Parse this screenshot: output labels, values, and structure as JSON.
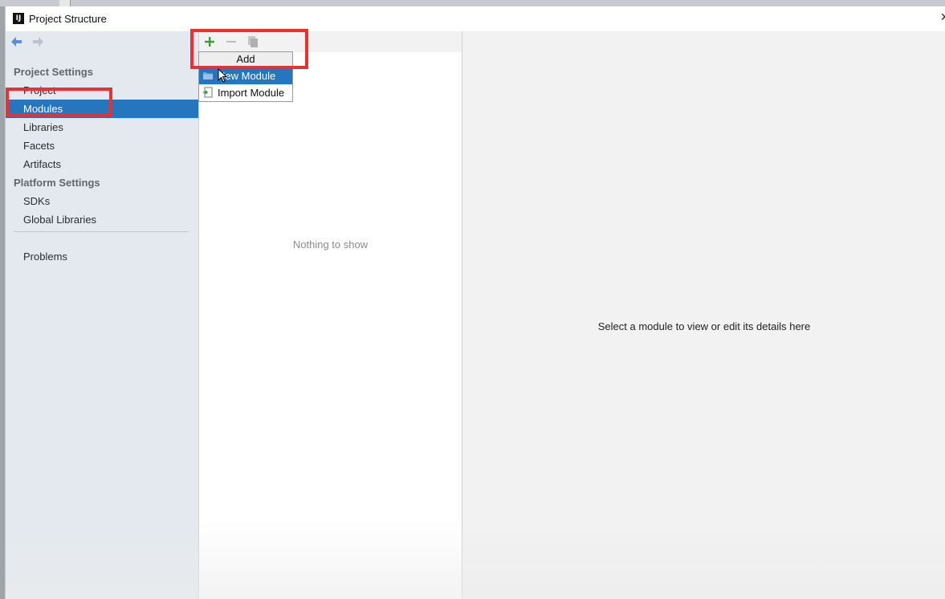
{
  "window": {
    "title": "Project Structure",
    "app_icon_text": "IJ",
    "close_glyph": "✕"
  },
  "sidebar": {
    "project_settings_header": "Project Settings",
    "platform_settings_header": "Platform Settings",
    "items": [
      {
        "label": "Project"
      },
      {
        "label": "Modules"
      },
      {
        "label": "Libraries"
      },
      {
        "label": "Facets"
      },
      {
        "label": "Artifacts"
      }
    ],
    "platform_items": [
      {
        "label": "SDKs"
      },
      {
        "label": "Global Libraries"
      }
    ],
    "problems_label": "Problems",
    "selected": "Modules"
  },
  "middle": {
    "empty_text": "Nothing to show"
  },
  "popup": {
    "title": "Add",
    "items": [
      {
        "label": "New Module",
        "icon": "folder-icon"
      },
      {
        "label": "Import Module",
        "icon": "import-module-icon"
      }
    ]
  },
  "right": {
    "message": "Select a module to view or edit its details here"
  },
  "colors": {
    "selection": "#2675bf",
    "highlight_box": "#e63232",
    "sidebar_bg": "#e4e9ef",
    "add_green": "#3a9c3a"
  }
}
